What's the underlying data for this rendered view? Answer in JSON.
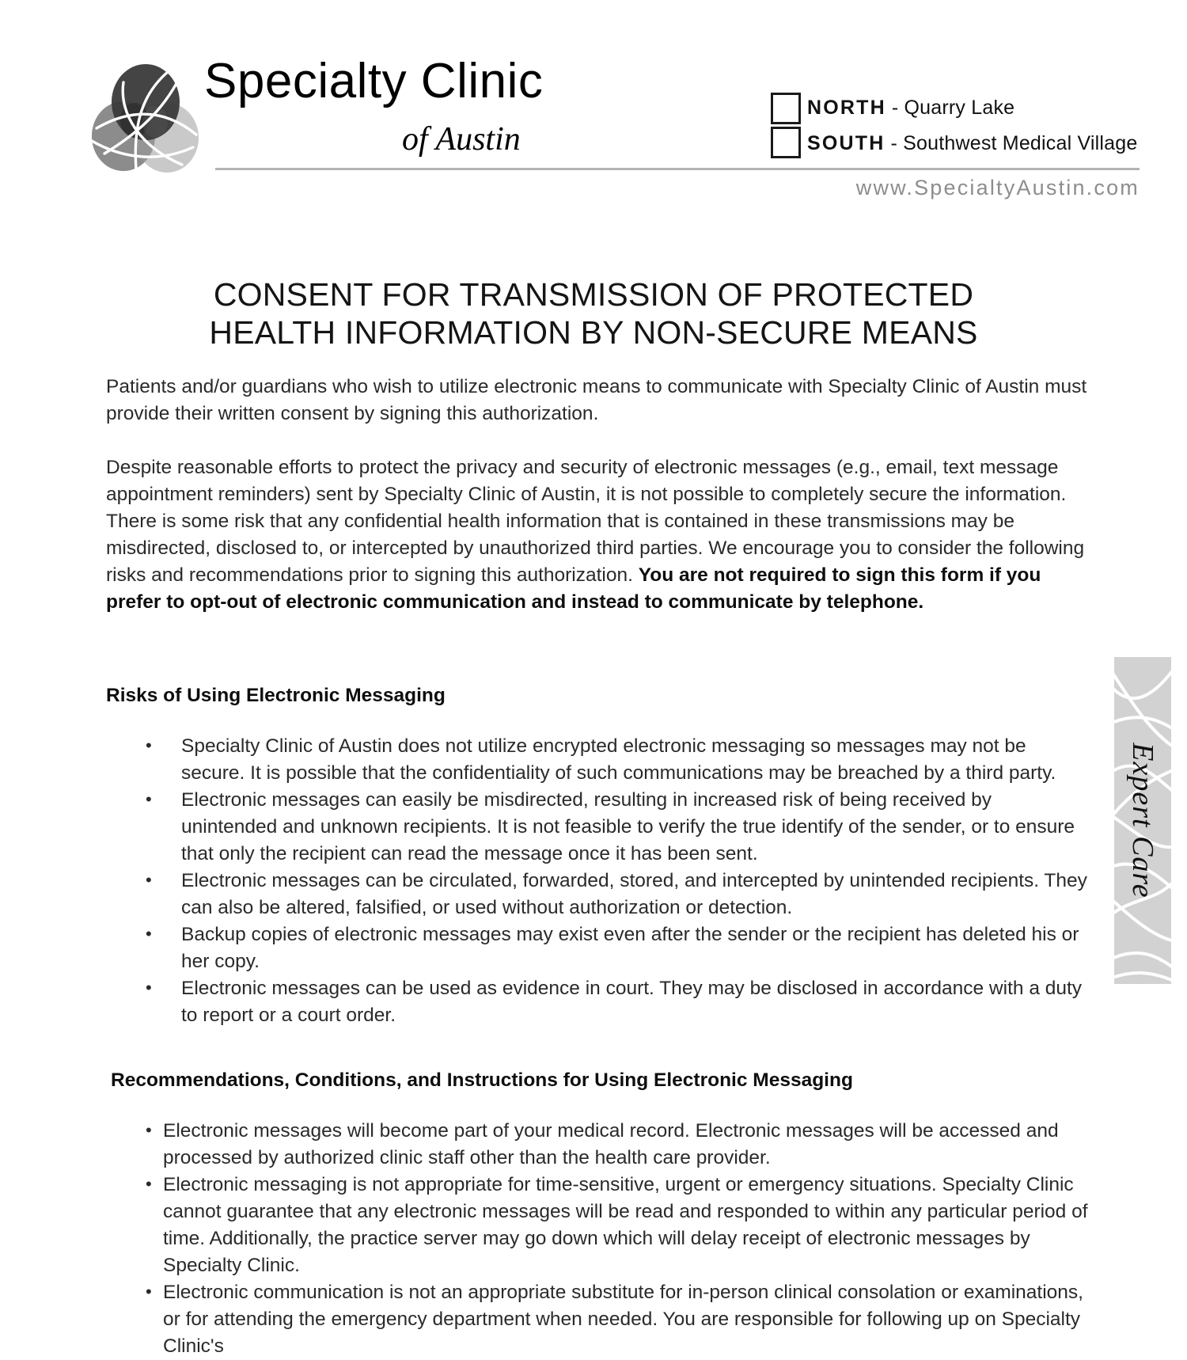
{
  "header": {
    "logo_icon": "three-overlapping-circles-logo",
    "brand_name": "Specialty Clinic",
    "brand_subtitle": "of Austin",
    "website": "www.SpecialtyAustin.com",
    "locations": [
      {
        "key": "NORTH",
        "value": "- Quarry Lake",
        "checked": false
      },
      {
        "key": "SOUTH",
        "value": "-  Southwest Medical Village",
        "checked": false
      }
    ]
  },
  "title": {
    "line1": "CONSENT FOR TRANSMISSION OF PROTECTED",
    "line2": "HEALTH INFORMATION BY NON-SECURE MEANS"
  },
  "body": {
    "para1": "Patients and/or guardians who wish to utilize electronic means to communicate with Specialty Clinic of Austin must provide their written consent by signing this authorization.",
    "para2_normal": "Despite reasonable efforts to protect the privacy and security of electronic messages (e.g., email, text message appointment reminders) sent by Specialty Clinic of Austin, it is not possible to completely secure the information. There is some risk that any confidential health information that is contained in these transmissions may be misdirected, disclosed to, or intercepted by unauthorized third parties. We encourage you to consider the following risks and recommendations prior to signing this authorization. ",
    "para2_bold": "You are not required to sign this form if you prefer to opt-out of electronic communication and instead to communicate by telephone."
  },
  "risks_section": {
    "heading": "Risks of Using Electronic Messaging",
    "items": [
      "Specialty Clinic of Austin does not utilize encrypted electronic messaging so messages may not be secure. It is possible that the confidentiality of such communications may be breached by a third party.",
      "Electronic messages can easily be misdirected, resulting in increased risk of being received by unintended and unknown recipients. It is not feasible to verify the true identify of the sender, or to ensure that only the recipient can read the message once it has been sent.",
      "Electronic messages can be circulated, forwarded, stored, and intercepted by unintended recipients. They can also be altered, falsified, or used without authorization or detection.",
      "Backup copies of electronic messages may exist even after the sender or the recipient has deleted his or her copy.",
      "Electronic messages can be used as evidence in court. They may be disclosed in accordance with a duty to report or a court order."
    ]
  },
  "recommendations_section": {
    "heading": "Recommendations, Conditions, and Instructions for Using Electronic Messaging",
    "items": [
      "Electronic messages will become part of your medical record. Electronic messages will be accessed and processed by authorized clinic staff other than the health care provider.",
      "Electronic messaging is not appropriate for time-sensitive, urgent or emergency situations. Specialty Clinic cannot guarantee that any electronic messages will be read and responded to within any particular period of time. Additionally, the practice server may go down which will delay receipt of electronic messages by Specialty Clinic.",
      "Electronic communication is not an appropriate substitute for in-person clinical consolation or examinations, or for attending the emergency department when needed. You are responsible for following up on Specialty Clinic's"
    ]
  },
  "side_tab": {
    "label": "Expert Care"
  },
  "colors": {
    "rule": "#b3b3b3",
    "website_text": "#8d8d8d",
    "side_tab_bg": "#d2d2d2",
    "logo_dark": "#3a3a3a",
    "logo_mid": "#8c8c8c",
    "logo_light": "#c9c9c9",
    "body_text": "#2a2a2a"
  }
}
